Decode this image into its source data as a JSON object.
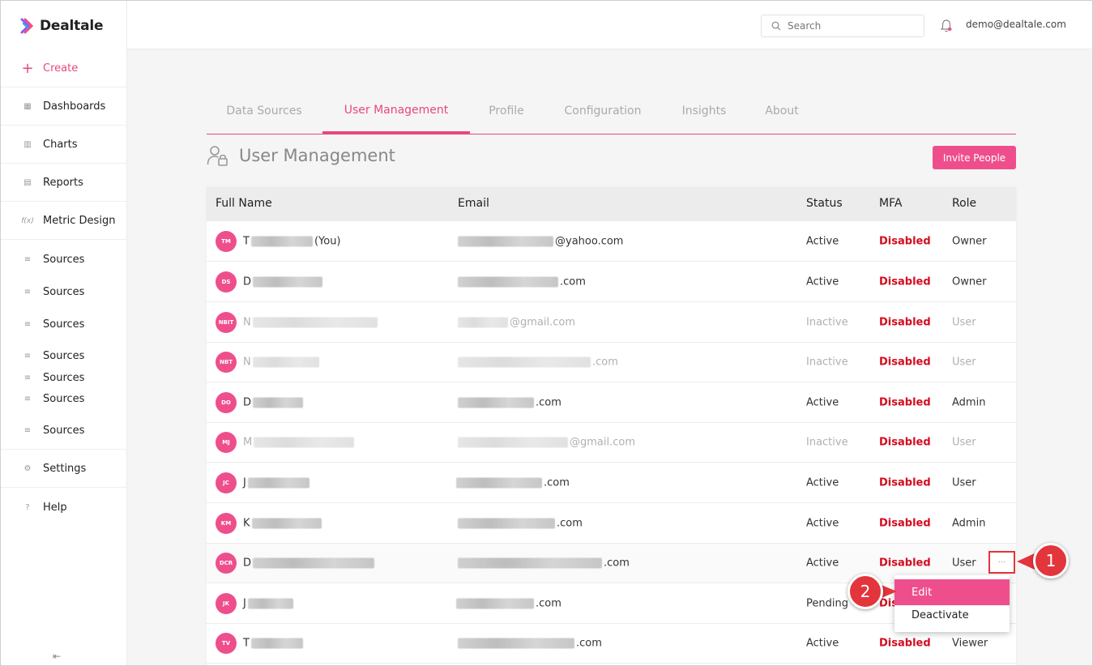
{
  "app": {
    "name": "Dealtale"
  },
  "sidebar": {
    "create": "Create",
    "items": [
      {
        "label": "Dashboards",
        "icon": "dashboard-icon"
      },
      {
        "label": "Charts",
        "icon": "chart-icon"
      },
      {
        "label": "Reports",
        "icon": "report-icon"
      },
      {
        "label": "Metric Design",
        "icon": "function-icon"
      },
      {
        "label": "Sources",
        "icon": "database-icon"
      },
      {
        "label": "Sources",
        "icon": "database-icon"
      },
      {
        "label": "Sources",
        "icon": "database-icon"
      },
      {
        "label": "Sources",
        "icon": "database-icon"
      },
      {
        "label": "Sources",
        "icon": "database-icon"
      },
      {
        "label": "Sources",
        "icon": "database-icon"
      },
      {
        "label": "Sources",
        "icon": "database-icon"
      },
      {
        "label": "Settings",
        "icon": "gear-icon"
      },
      {
        "label": "Help",
        "icon": "help-icon"
      }
    ]
  },
  "header": {
    "search_placeholder": "Search",
    "user_email": "demo@dealtale.com"
  },
  "tabs": [
    "Data Sources",
    "User Management",
    "Profile",
    "Configuration",
    "Insights",
    "About"
  ],
  "active_tab": "User Management",
  "page": {
    "title": "User Management",
    "invite_label": "Invite People"
  },
  "table": {
    "columns": [
      "Full Name",
      "Email",
      "Status",
      "MFA",
      "Role"
    ],
    "rows": [
      {
        "initials": "TM",
        "name": "T",
        "name_suffix": "(You)",
        "email": "@yahoo.com",
        "status": "Active",
        "mfa": "Disabled",
        "role": "Owner",
        "inactive": false
      },
      {
        "initials": "DS",
        "name": "D",
        "name_suffix": "",
        "email": ".com",
        "status": "Active",
        "mfa": "Disabled",
        "role": "Owner",
        "inactive": false
      },
      {
        "initials": "NBIT",
        "name": "N",
        "name_suffix": "",
        "email": "@gmail.com",
        "status": "Inactive",
        "mfa": "Disabled",
        "role": "User",
        "inactive": true
      },
      {
        "initials": "NBT",
        "name": "N",
        "name_suffix": "",
        "email": ".com",
        "status": "Inactive",
        "mfa": "Disabled",
        "role": "User",
        "inactive": true
      },
      {
        "initials": "DO",
        "name": "D",
        "name_suffix": "",
        "email": ".com",
        "status": "Active",
        "mfa": "Disabled",
        "role": "Admin",
        "inactive": false
      },
      {
        "initials": "MJ",
        "name": "M",
        "name_suffix": "",
        "email": "@gmail.com",
        "status": "Inactive",
        "mfa": "Disabled",
        "role": "User",
        "inactive": true
      },
      {
        "initials": "JC",
        "name": "J",
        "name_suffix": "",
        "email": ".com",
        "status": "Active",
        "mfa": "Disabled",
        "role": "User",
        "inactive": false
      },
      {
        "initials": "KM",
        "name": "K",
        "name_suffix": "",
        "email": ".com",
        "status": "Active",
        "mfa": "Disabled",
        "role": "Admin",
        "inactive": false
      },
      {
        "initials": "DCR",
        "name": "D",
        "name_suffix": "",
        "email": ".com",
        "status": "Active",
        "mfa": "Disabled",
        "role": "User",
        "inactive": false
      },
      {
        "initials": "JK",
        "name": "J",
        "name_suffix": "",
        "email": ".com",
        "status": "Pending",
        "mfa": "Dis",
        "role": "",
        "inactive": false
      },
      {
        "initials": "TV",
        "name": "T",
        "name_suffix": "",
        "email": ".com",
        "status": "Active",
        "mfa": "Disabled",
        "role": "Viewer",
        "inactive": false
      }
    ]
  },
  "row_menu": {
    "more_label": "···",
    "items": [
      "Edit",
      "Deactivate"
    ]
  },
  "callouts": [
    "1",
    "2"
  ],
  "colors": {
    "accent": "#ee4f8c",
    "mfa_disabled": "#d40b1f",
    "callout": "#e3353c"
  }
}
